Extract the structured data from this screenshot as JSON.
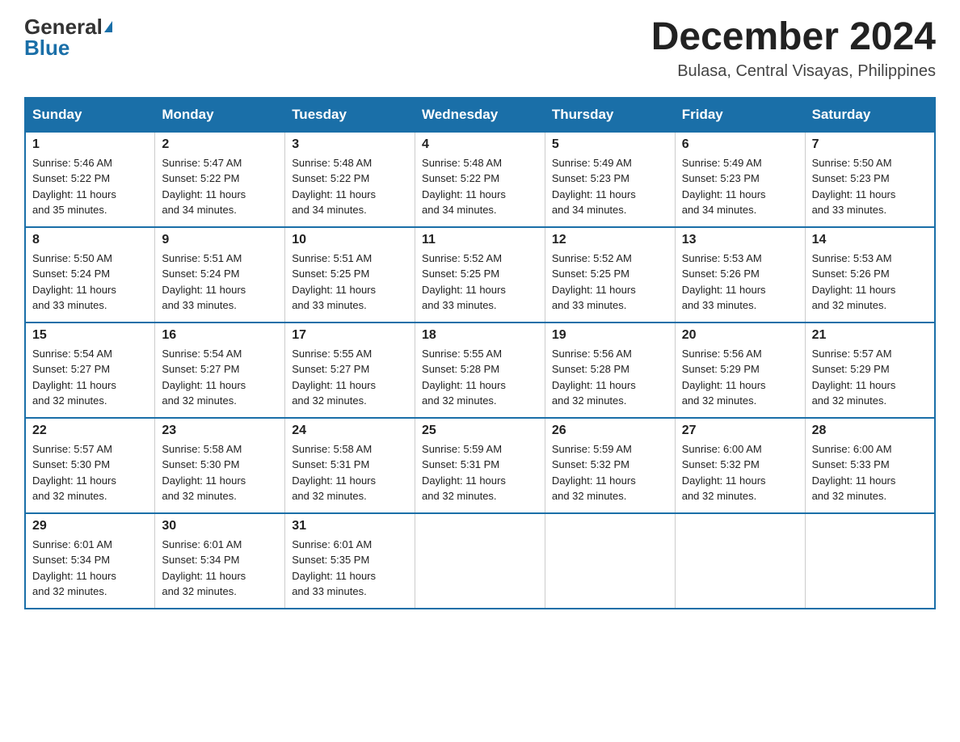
{
  "logo": {
    "general": "General",
    "blue": "Blue"
  },
  "header": {
    "month": "December 2024",
    "location": "Bulasa, Central Visayas, Philippines"
  },
  "days_of_week": [
    "Sunday",
    "Monday",
    "Tuesday",
    "Wednesday",
    "Thursday",
    "Friday",
    "Saturday"
  ],
  "weeks": [
    [
      {
        "day": "1",
        "info": "Sunrise: 5:46 AM\nSunset: 5:22 PM\nDaylight: 11 hours\nand 35 minutes."
      },
      {
        "day": "2",
        "info": "Sunrise: 5:47 AM\nSunset: 5:22 PM\nDaylight: 11 hours\nand 34 minutes."
      },
      {
        "day": "3",
        "info": "Sunrise: 5:48 AM\nSunset: 5:22 PM\nDaylight: 11 hours\nand 34 minutes."
      },
      {
        "day": "4",
        "info": "Sunrise: 5:48 AM\nSunset: 5:22 PM\nDaylight: 11 hours\nand 34 minutes."
      },
      {
        "day": "5",
        "info": "Sunrise: 5:49 AM\nSunset: 5:23 PM\nDaylight: 11 hours\nand 34 minutes."
      },
      {
        "day": "6",
        "info": "Sunrise: 5:49 AM\nSunset: 5:23 PM\nDaylight: 11 hours\nand 34 minutes."
      },
      {
        "day": "7",
        "info": "Sunrise: 5:50 AM\nSunset: 5:23 PM\nDaylight: 11 hours\nand 33 minutes."
      }
    ],
    [
      {
        "day": "8",
        "info": "Sunrise: 5:50 AM\nSunset: 5:24 PM\nDaylight: 11 hours\nand 33 minutes."
      },
      {
        "day": "9",
        "info": "Sunrise: 5:51 AM\nSunset: 5:24 PM\nDaylight: 11 hours\nand 33 minutes."
      },
      {
        "day": "10",
        "info": "Sunrise: 5:51 AM\nSunset: 5:25 PM\nDaylight: 11 hours\nand 33 minutes."
      },
      {
        "day": "11",
        "info": "Sunrise: 5:52 AM\nSunset: 5:25 PM\nDaylight: 11 hours\nand 33 minutes."
      },
      {
        "day": "12",
        "info": "Sunrise: 5:52 AM\nSunset: 5:25 PM\nDaylight: 11 hours\nand 33 minutes."
      },
      {
        "day": "13",
        "info": "Sunrise: 5:53 AM\nSunset: 5:26 PM\nDaylight: 11 hours\nand 33 minutes."
      },
      {
        "day": "14",
        "info": "Sunrise: 5:53 AM\nSunset: 5:26 PM\nDaylight: 11 hours\nand 32 minutes."
      }
    ],
    [
      {
        "day": "15",
        "info": "Sunrise: 5:54 AM\nSunset: 5:27 PM\nDaylight: 11 hours\nand 32 minutes."
      },
      {
        "day": "16",
        "info": "Sunrise: 5:54 AM\nSunset: 5:27 PM\nDaylight: 11 hours\nand 32 minutes."
      },
      {
        "day": "17",
        "info": "Sunrise: 5:55 AM\nSunset: 5:27 PM\nDaylight: 11 hours\nand 32 minutes."
      },
      {
        "day": "18",
        "info": "Sunrise: 5:55 AM\nSunset: 5:28 PM\nDaylight: 11 hours\nand 32 minutes."
      },
      {
        "day": "19",
        "info": "Sunrise: 5:56 AM\nSunset: 5:28 PM\nDaylight: 11 hours\nand 32 minutes."
      },
      {
        "day": "20",
        "info": "Sunrise: 5:56 AM\nSunset: 5:29 PM\nDaylight: 11 hours\nand 32 minutes."
      },
      {
        "day": "21",
        "info": "Sunrise: 5:57 AM\nSunset: 5:29 PM\nDaylight: 11 hours\nand 32 minutes."
      }
    ],
    [
      {
        "day": "22",
        "info": "Sunrise: 5:57 AM\nSunset: 5:30 PM\nDaylight: 11 hours\nand 32 minutes."
      },
      {
        "day": "23",
        "info": "Sunrise: 5:58 AM\nSunset: 5:30 PM\nDaylight: 11 hours\nand 32 minutes."
      },
      {
        "day": "24",
        "info": "Sunrise: 5:58 AM\nSunset: 5:31 PM\nDaylight: 11 hours\nand 32 minutes."
      },
      {
        "day": "25",
        "info": "Sunrise: 5:59 AM\nSunset: 5:31 PM\nDaylight: 11 hours\nand 32 minutes."
      },
      {
        "day": "26",
        "info": "Sunrise: 5:59 AM\nSunset: 5:32 PM\nDaylight: 11 hours\nand 32 minutes."
      },
      {
        "day": "27",
        "info": "Sunrise: 6:00 AM\nSunset: 5:32 PM\nDaylight: 11 hours\nand 32 minutes."
      },
      {
        "day": "28",
        "info": "Sunrise: 6:00 AM\nSunset: 5:33 PM\nDaylight: 11 hours\nand 32 minutes."
      }
    ],
    [
      {
        "day": "29",
        "info": "Sunrise: 6:01 AM\nSunset: 5:34 PM\nDaylight: 11 hours\nand 32 minutes."
      },
      {
        "day": "30",
        "info": "Sunrise: 6:01 AM\nSunset: 5:34 PM\nDaylight: 11 hours\nand 32 minutes."
      },
      {
        "day": "31",
        "info": "Sunrise: 6:01 AM\nSunset: 5:35 PM\nDaylight: 11 hours\nand 33 minutes."
      },
      {
        "day": "",
        "info": ""
      },
      {
        "day": "",
        "info": ""
      },
      {
        "day": "",
        "info": ""
      },
      {
        "day": "",
        "info": ""
      }
    ]
  ]
}
